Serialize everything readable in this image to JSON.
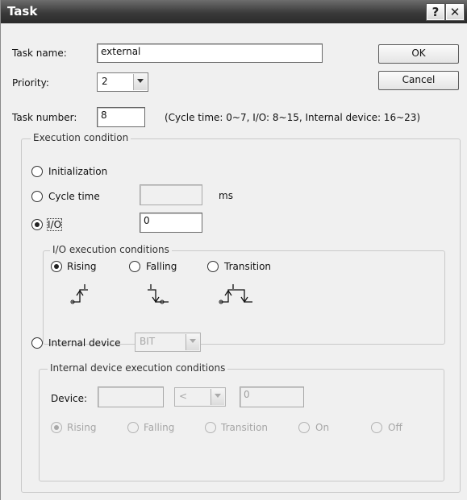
{
  "window": {
    "title": "Task",
    "help_icon": "?",
    "close_icon": "✕"
  },
  "form": {
    "task_name_label": "Task name:",
    "task_name_value": "external",
    "priority_label": "Priority:",
    "priority_value": "2",
    "task_number_label": "Task number:",
    "task_number_value": "8",
    "task_number_hint": "(Cycle time: 0~7, I/O: 8~15, Internal device: 16~23)"
  },
  "buttons": {
    "ok": "OK",
    "cancel": "Cancel"
  },
  "execution": {
    "legend": "Execution condition",
    "initialization_label": "Initialization",
    "cycle_time_label": "Cycle time",
    "cycle_time_value": "",
    "cycle_time_unit": "ms",
    "io_label": "I/O",
    "io_value": "0",
    "selected": "io"
  },
  "io_conditions": {
    "legend": "I/O execution conditions",
    "rising": "Rising",
    "falling": "Falling",
    "transition": "Transition",
    "selected": "rising"
  },
  "internal": {
    "label": "Internal device",
    "type_value": "BIT",
    "legend": "Internal device execution conditions",
    "device_label": "Device:",
    "device_value": "",
    "operator_value": "<",
    "compare_value": "0",
    "rising": "Rising",
    "falling": "Falling",
    "transition": "Transition",
    "on": "On",
    "off": "Off",
    "selected": "rising"
  },
  "colors": {
    "titlebar": "#3a3a3a",
    "dialog_bg": "#f0f0f0",
    "disabled_text": "#a6a6a6"
  }
}
